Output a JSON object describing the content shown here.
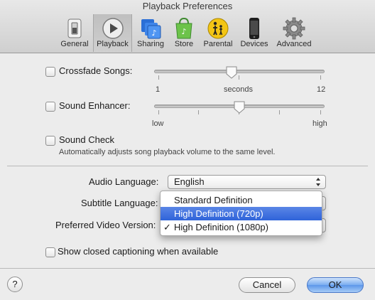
{
  "window": {
    "title": "Playback Preferences"
  },
  "toolbar": {
    "items": [
      {
        "label": "General",
        "icon": "switch-icon"
      },
      {
        "label": "Playback",
        "icon": "play-icon",
        "selected": true
      },
      {
        "label": "Sharing",
        "icon": "sharing-icon"
      },
      {
        "label": "Store",
        "icon": "shopping-bag-icon"
      },
      {
        "label": "Parental",
        "icon": "parental-icon"
      },
      {
        "label": "Devices",
        "icon": "iphone-icon"
      },
      {
        "label": "Advanced",
        "icon": "gear-icon"
      }
    ]
  },
  "crossfade": {
    "label": "Crossfade Songs:",
    "checked": false,
    "min_label": "1",
    "mid_label": "seconds",
    "max_label": "12",
    "value": 6
  },
  "sound_enhancer": {
    "label": "Sound Enhancer:",
    "checked": false,
    "min_label": "low",
    "max_label": "high",
    "value": 0.5
  },
  "sound_check": {
    "label": "Sound Check",
    "checked": false,
    "description": "Automatically adjusts song playback volume to the same level."
  },
  "audio_language": {
    "label": "Audio Language:",
    "value": "English"
  },
  "subtitle_language": {
    "label": "Subtitle Language:"
  },
  "preferred_video": {
    "label": "Preferred Video Version:"
  },
  "video_menu": {
    "options": [
      {
        "label": "Standard Definition",
        "checked": false,
        "highlighted": false
      },
      {
        "label": "High Definition (720p)",
        "checked": false,
        "highlighted": true
      },
      {
        "label": "High Definition (1080p)",
        "checked": true,
        "highlighted": false
      }
    ],
    "check_mark": "✓"
  },
  "closed_captioning": {
    "label": "Show closed captioning when available",
    "checked": false
  },
  "buttons": {
    "help": "?",
    "cancel": "Cancel",
    "ok": "OK"
  },
  "colors": {
    "highlight": "#2f63d9",
    "default_button": "#5d97ea"
  }
}
